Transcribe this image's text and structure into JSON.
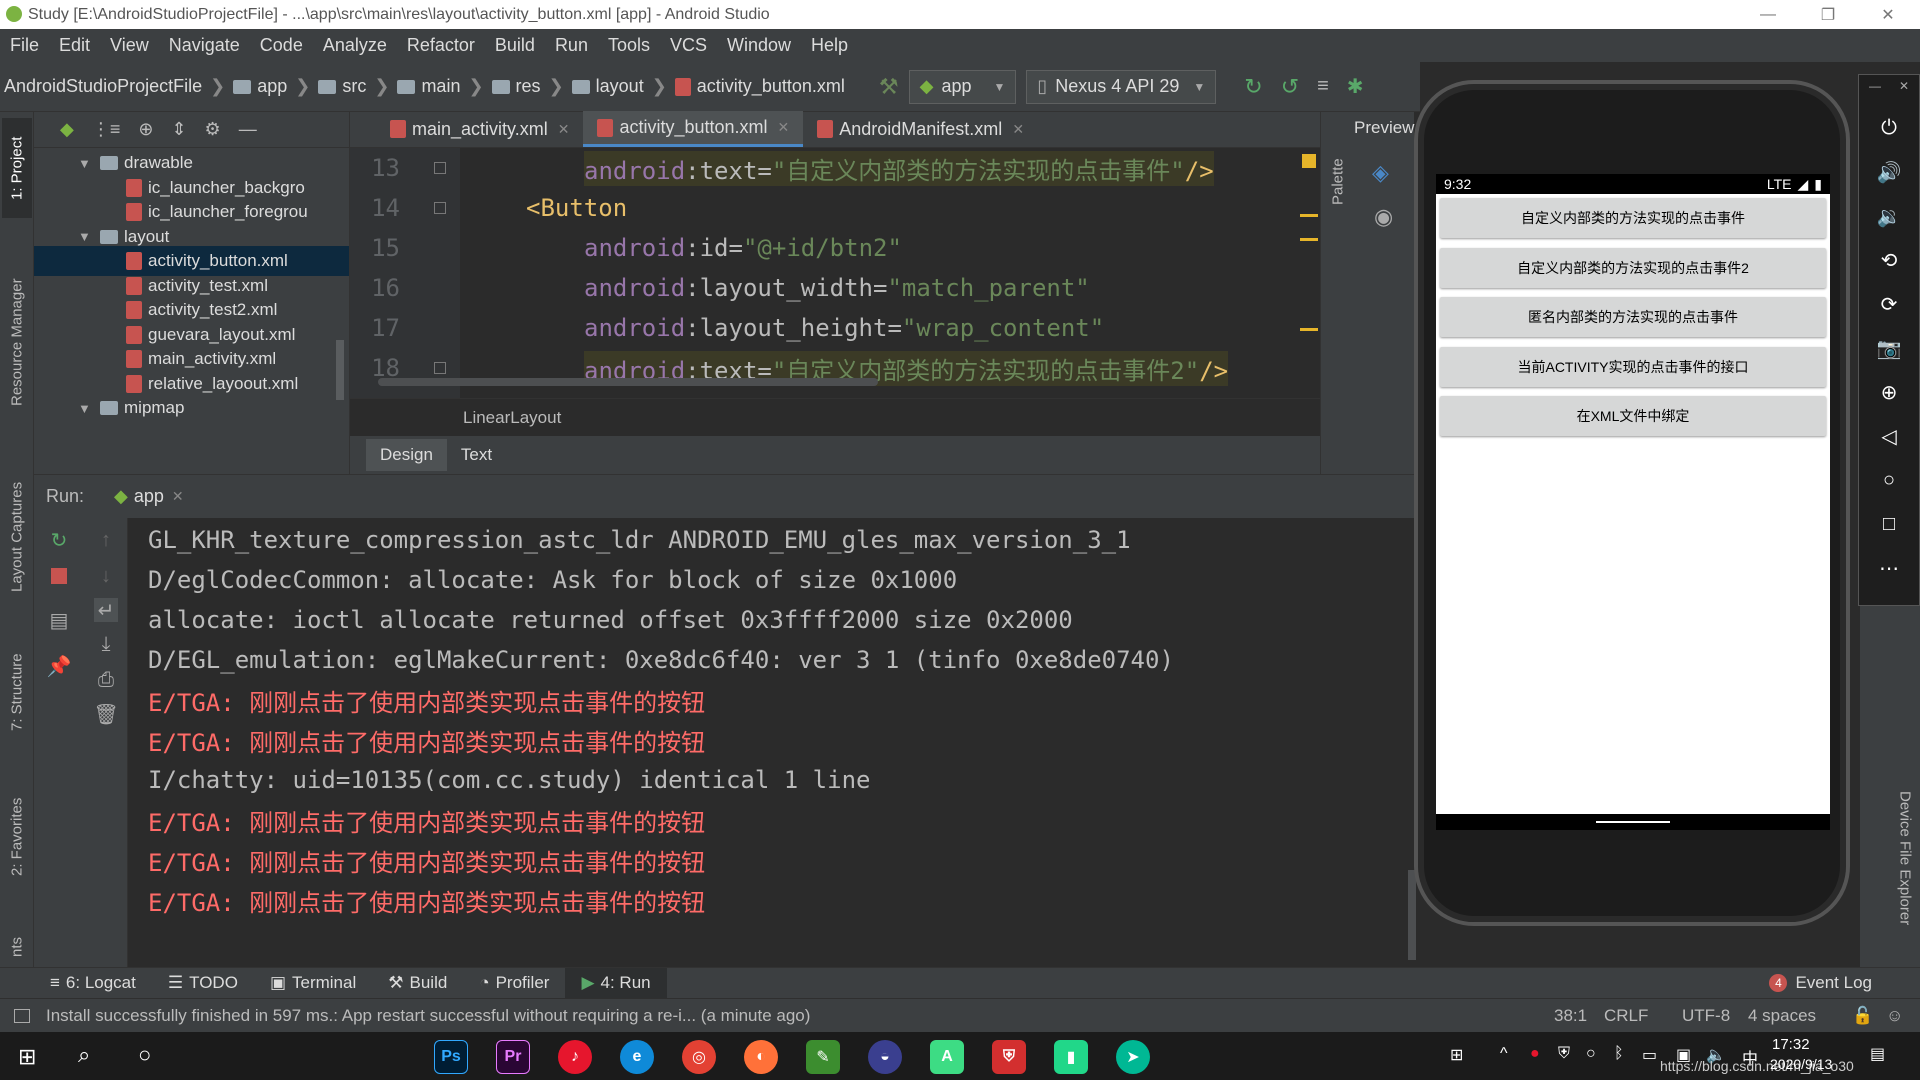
{
  "window": {
    "title": "Study [E:\\AndroidStudioProjectFile] - ...\\app\\src\\main\\res\\layout\\activity_button.xml [app] - Android Studio",
    "minimize": "—",
    "maximize": "❐",
    "close": "✕"
  },
  "menu": [
    "File",
    "Edit",
    "View",
    "Navigate",
    "Code",
    "Analyze",
    "Refactor",
    "Build",
    "Run",
    "Tools",
    "VCS",
    "Window",
    "Help"
  ],
  "breadcrumbs": [
    "AndroidStudioProjectFile",
    "app",
    "src",
    "main",
    "res",
    "layout",
    "activity_button.xml"
  ],
  "toolbar": {
    "run_config": "app",
    "device": "Nexus 4 API 29"
  },
  "left_tool_tabs": [
    "1: Project",
    "Resource Manager",
    "Layout Captures",
    "7: Structure",
    "2: Favorites",
    "nts"
  ],
  "project_tree": [
    {
      "label": "drawable",
      "type": "folder",
      "expanded": true,
      "indent": 0
    },
    {
      "label": "ic_launcher_backgro",
      "type": "xml",
      "indent": 1
    },
    {
      "label": "ic_launcher_foregrou",
      "type": "xml",
      "indent": 1
    },
    {
      "label": "layout",
      "type": "folder",
      "expanded": true,
      "indent": 0
    },
    {
      "label": "activity_button.xml",
      "type": "xml",
      "indent": 1,
      "selected": true
    },
    {
      "label": "activity_test.xml",
      "type": "xml",
      "indent": 1
    },
    {
      "label": "activity_test2.xml",
      "type": "xml",
      "indent": 1
    },
    {
      "label": "guevara_layout.xml",
      "type": "xml",
      "indent": 1
    },
    {
      "label": "main_activity.xml",
      "type": "xml",
      "indent": 1
    },
    {
      "label": "relative_layoout.xml",
      "type": "xml",
      "indent": 1
    },
    {
      "label": "mipmap",
      "type": "folder",
      "expanded": true,
      "indent": 0
    }
  ],
  "editor_tabs": [
    {
      "label": "main_activity.xml",
      "active": false
    },
    {
      "label": "activity_button.xml",
      "active": true
    },
    {
      "label": "AndroidManifest.xml",
      "active": false
    }
  ],
  "editor": {
    "lines": [
      {
        "num": "13",
        "ns": "android",
        "attr": "text",
        "val": "\"自定义内部类的方法实现的点击事件\"",
        "close": "/>",
        "highlight": true
      },
      {
        "num": "14",
        "tag": "<Button"
      },
      {
        "num": "15",
        "ns": "android",
        "attr": "id",
        "val": "\"@+id/btn2\""
      },
      {
        "num": "16",
        "ns": "android",
        "attr": "layout_width",
        "val": "\"match_parent\""
      },
      {
        "num": "17",
        "ns": "android",
        "attr": "layout_height",
        "val": "\"wrap_content\""
      },
      {
        "num": "18",
        "ns": "android",
        "attr": "text",
        "val": "\"自定义内部类的方法实现的点击事件2\"",
        "close": "/>",
        "highlight": true
      }
    ],
    "breadcrumb": "LinearLayout",
    "design_tabs": [
      "Design",
      "Text"
    ]
  },
  "side_panels": {
    "palette": "Palette",
    "preview": "Preview"
  },
  "run": {
    "label": "Run:",
    "config": "app",
    "console": [
      {
        "text": " GL_KHR_texture_compression_astc_ldr ANDROID_EMU_gles_max_version_3_1",
        "level": "info"
      },
      {
        "text": "D/eglCodecCommon: allocate: Ask for block of size 0x1000",
        "level": "info"
      },
      {
        "text": "    allocate: ioctl allocate returned offset 0x3ffff2000 size 0x2000",
        "level": "info"
      },
      {
        "text": "D/EGL_emulation: eglMakeCurrent: 0xe8dc6f40: ver 3 1 (tinfo 0xe8de0740)",
        "level": "info"
      },
      {
        "text": "E/TGA: 刚刚点击了使用内部类实现点击事件的按钮",
        "level": "error"
      },
      {
        "text": "E/TGA: 刚刚点击了使用内部类实现点击事件的按钮",
        "level": "error"
      },
      {
        "text": "I/chatty: uid=10135(com.cc.study) identical 1 line",
        "level": "info"
      },
      {
        "text": "E/TGA: 刚刚点击了使用内部类实现点击事件的按钮",
        "level": "error"
      },
      {
        "text": "E/TGA: 刚刚点击了使用内部类实现点击事件的按钮",
        "level": "error"
      },
      {
        "text": "E/TGA: 刚刚点击了使用内部类实现点击事件的按钮",
        "level": "error"
      }
    ]
  },
  "emulator": {
    "time": "9:32",
    "network": "LTE",
    "buttons": [
      "自定义内部类的方法实现的点击事件",
      "自定义内部类的方法实现的点击事件2",
      "匿名内部类的方法实现的点击事件",
      "当前ACTIVITY实现的点击事件的接口",
      "在XML文件中绑定"
    ],
    "device_file_explorer": "Device File Explorer"
  },
  "bottom_tabs": [
    {
      "label": "6: Logcat",
      "active": false
    },
    {
      "label": "TODO",
      "active": false
    },
    {
      "label": "Terminal",
      "active": false
    },
    {
      "label": "Build",
      "active": false
    },
    {
      "label": "Profiler",
      "active": false
    },
    {
      "label": "4: Run",
      "active": true
    }
  ],
  "event_log": {
    "count": "4",
    "label": "Event Log"
  },
  "status": {
    "message": "Install successfully finished in 597 ms.: App restart successful without requiring a re-i... (a minute ago)",
    "position": "38:1",
    "line_sep": "CRLF",
    "encoding": "UTF-8",
    "indent": "4 spaces"
  },
  "taskbar": {
    "apps": [
      "Ps",
      "Pr"
    ],
    "time": "17:32",
    "date": "2020/9/13",
    "watermark": "https://blog.csdn.net/m_jia_o30"
  }
}
